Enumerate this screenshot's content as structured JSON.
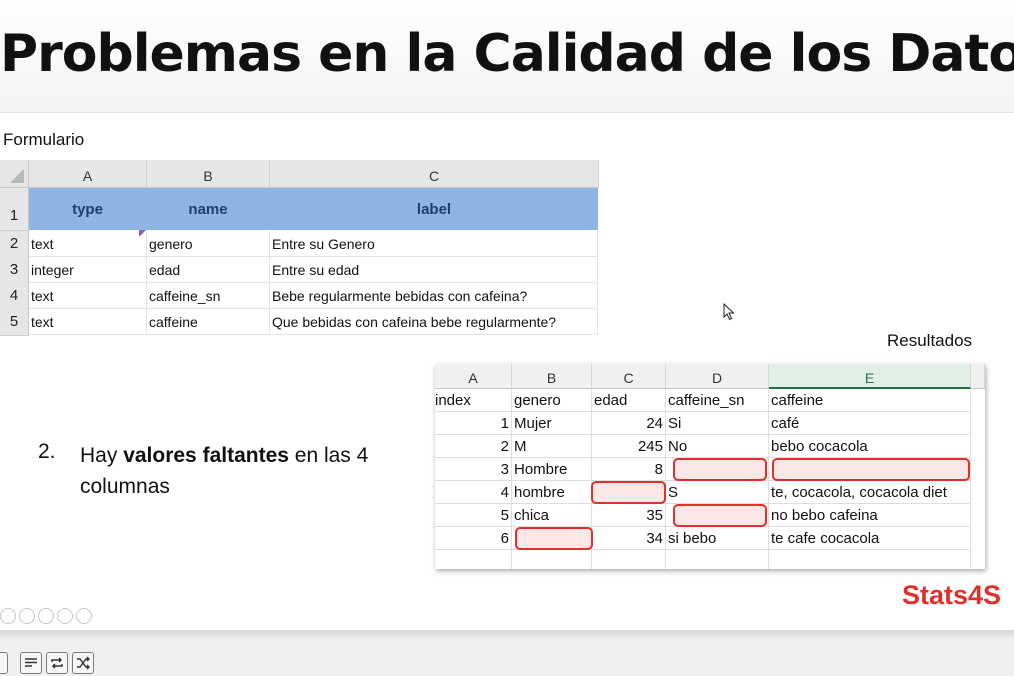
{
  "slide": {
    "title": "Problemas en la Calidad de los Datos",
    "form_label": "Formulario",
    "results_label": "Resultados",
    "brand": "Stats4S"
  },
  "form_sheet": {
    "columns": [
      "A",
      "B",
      "C"
    ],
    "rows": [
      "1",
      "2",
      "3",
      "4",
      "5"
    ],
    "header": [
      "type",
      "name",
      "label"
    ],
    "data": [
      [
        "text",
        "genero",
        "Entre su Genero"
      ],
      [
        "integer",
        "edad",
        "Entre su edad"
      ],
      [
        "text",
        "caffeine_sn",
        "Bebe regularmente bebidas con cafeina?"
      ],
      [
        "text",
        "caffeine",
        "Que bebidas con cafeina bebe regularmente?"
      ]
    ],
    "header_color": "#8db4e2"
  },
  "results_sheet": {
    "columns": [
      "A",
      "B",
      "C",
      "D",
      "E"
    ],
    "active_column": "E",
    "header": [
      "index",
      "genero",
      "edad",
      "caffeine_sn",
      "caffeine"
    ],
    "data": [
      [
        "1",
        "Mujer",
        "24",
        "Si",
        "café"
      ],
      [
        "2",
        "M",
        "245",
        "No",
        "bebo cocacola"
      ],
      [
        "3",
        "Hombre",
        "8",
        "",
        ""
      ],
      [
        "4",
        "hombre",
        "",
        "S",
        "te, cocacola, cocacola diet"
      ],
      [
        "5",
        "chica",
        "35",
        "",
        "no bebo cafeina"
      ],
      [
        "6",
        "",
        "34",
        "si bebo",
        "te cafe cocacola"
      ]
    ],
    "missing_highlight_color": "#e0302b"
  },
  "list": {
    "number": "2.",
    "prefix": "Hay ",
    "bold": "valores faltantes",
    "suffix": " en las 4 columnas"
  },
  "toolbar": {
    "icons": [
      "playlist-icon",
      "repeat-icon",
      "shuffle-icon"
    ]
  }
}
